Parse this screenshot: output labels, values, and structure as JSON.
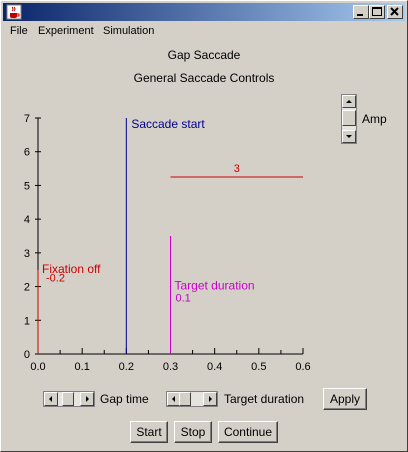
{
  "window": {
    "title": ""
  },
  "menu": [
    "File",
    "Experiment",
    "Simulation"
  ],
  "panel": {
    "title": "Gap Saccade",
    "subtitle": "General Saccade Controls"
  },
  "amp_label": "Amp",
  "chart_data": {
    "type": "line",
    "x_ticks": [
      "0.0",
      "0.1",
      "0.2",
      "0.3",
      "0.4",
      "0.5",
      "0.6"
    ],
    "y_ticks": [
      "0",
      "1",
      "2",
      "3",
      "4",
      "5",
      "6",
      "7"
    ],
    "xlim": [
      0,
      0.6
    ],
    "ylim": [
      0,
      7
    ],
    "series": [
      {
        "label": "Saccade start",
        "color": "#00008b",
        "x": [
          0.2,
          0.2
        ],
        "y": [
          0,
          7
        ]
      },
      {
        "label": "Target duration",
        "value_label": "0.1",
        "color": "#cc00cc",
        "x": [
          0.3,
          0.3
        ],
        "y": [
          0,
          3.5
        ]
      },
      {
        "label": "Fixation off",
        "value_label": "-0.2",
        "color": "#cc0000",
        "x": [
          0.0,
          0.0
        ],
        "y": [
          0,
          2.5
        ]
      },
      {
        "label": "3",
        "color": "#cc0000",
        "x": [
          0.3,
          0.6
        ],
        "y": [
          5.25,
          5.25
        ]
      }
    ]
  },
  "controls": {
    "gap_time_label": "Gap time",
    "gap_time_value": 0.2,
    "target_duration_label": "Target duration",
    "target_duration_value": 0.1,
    "apply_label": "Apply",
    "start_label": "Start",
    "stop_label": "Stop",
    "continue_label": "Continue"
  },
  "colors": {
    "titlebar_start": "#0a246a",
    "titlebar_end": "#a6caf0",
    "window_bg": "#d4d0c8"
  }
}
